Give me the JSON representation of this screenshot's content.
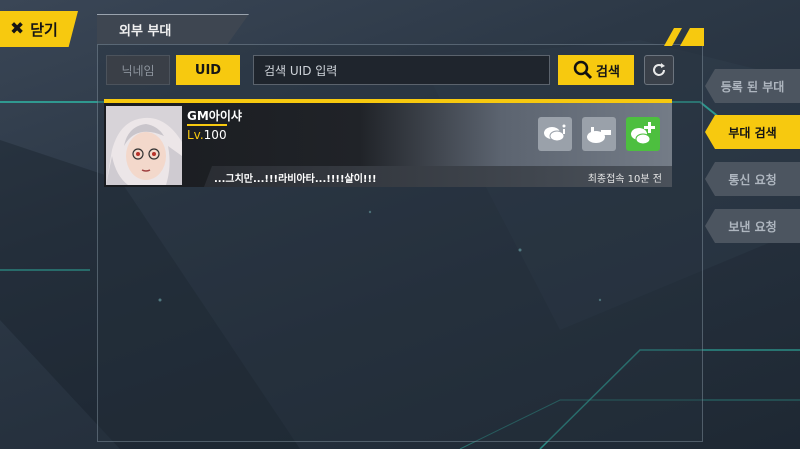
{
  "close_button": {
    "label": "닫기",
    "icon": "close-icon"
  },
  "panel": {
    "title": "외부 부대"
  },
  "search": {
    "tabs": [
      {
        "label": "닉네임",
        "active": false
      },
      {
        "label": "UID",
        "active": true
      }
    ],
    "placeholder": "검색 UID 입력",
    "button_label": "검색",
    "refresh_icon": "refresh-icon"
  },
  "player": {
    "name": "GM아이샤",
    "level_prefix": "Lv.",
    "level": "100",
    "status_message": "...그치만...!!!라비아타...!!!!살이!!!",
    "last_login": "최종접속 10분 전",
    "actions": [
      "chat-icon",
      "whistle-icon",
      "add-friend-icon"
    ]
  },
  "side_menu": [
    {
      "label": "등록 된 부대",
      "active": false
    },
    {
      "label": "부대 검색",
      "active": true
    },
    {
      "label": "통신 요청",
      "active": false
    },
    {
      "label": "보낸 요청",
      "active": false
    }
  ],
  "colors": {
    "accent": "#f7c90f",
    "add_green": "#4dbf3f"
  }
}
